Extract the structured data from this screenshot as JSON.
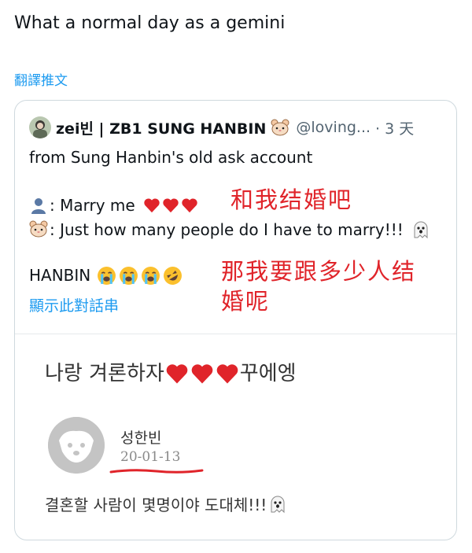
{
  "tweet": {
    "text": "What a normal day as a gemini",
    "translate_label": "翻譯推文"
  },
  "quote": {
    "author_name": "zei빈 | ZB1 SUNG HANBIN",
    "handle": "@loving...",
    "time": "· 3 天",
    "line1": "from Sung Hanbin's old ask account",
    "line2": ": Marry me",
    "line3": ": Just how many people do I have to marry!!!",
    "line4": "HANBIN",
    "show_thread": "顯示此對話串",
    "annotation1": "和我结婚吧",
    "annotation2_line1": "那我要跟多少人结",
    "annotation2_line2": "婚呢"
  },
  "ask": {
    "title_prefix": "나랑 겨론하자",
    "title_suffix": "꾸에엥",
    "name": "성한빈",
    "date": "20-01-13",
    "body": "결혼할 사람이 몇명이야 도대체!!!"
  },
  "colors": {
    "accent": "#1d9bf0",
    "annotation_red": "#e0242a",
    "heart_red": "#e0242a"
  },
  "icons": [
    "hamster-emoji-icon",
    "person-silhouette-icon",
    "red-heart-icon",
    "ghost-emoji-icon",
    "loudly-crying-face-icon",
    "rolling-on-floor-laughing-icon",
    "default-avatar-icon"
  ]
}
